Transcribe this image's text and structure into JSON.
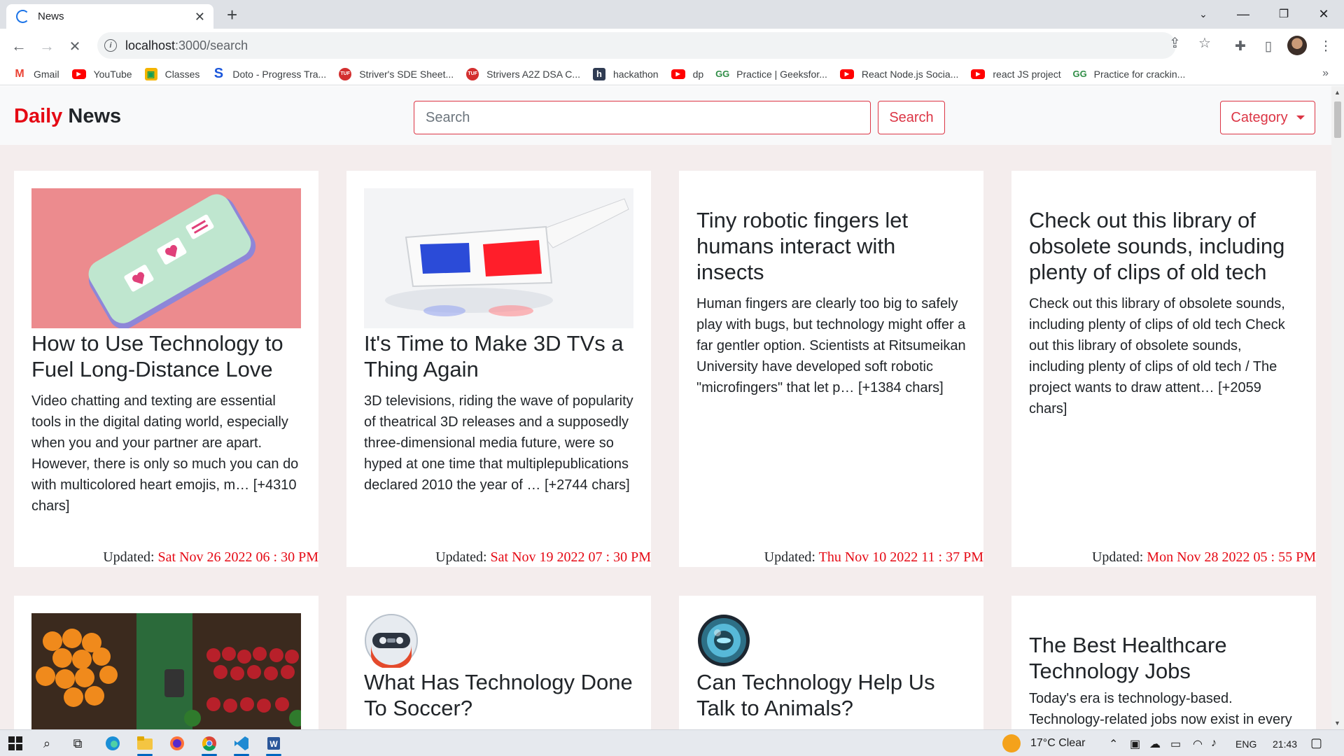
{
  "browser": {
    "tab_title": "News",
    "url_host": "localhost",
    "url_rest": ":3000/search",
    "bookmarks": [
      {
        "label": "Gmail",
        "icon": "gmail-icon"
      },
      {
        "label": "YouTube",
        "icon": "youtube-icon"
      },
      {
        "label": "Classes",
        "icon": "classroom-icon"
      },
      {
        "label": "Doto - Progress Tra...",
        "icon": "doto-icon"
      },
      {
        "label": "Striver's SDE Sheet...",
        "icon": "tuf-icon"
      },
      {
        "label": "Strivers A2Z DSA C...",
        "icon": "tuf-icon"
      },
      {
        "label": "hackathon",
        "icon": "hashnode-icon"
      },
      {
        "label": "dp",
        "icon": "youtube-icon"
      },
      {
        "label": "Practice | Geeksfor...",
        "icon": "gfg-icon"
      },
      {
        "label": "React Node.js Socia...",
        "icon": "youtube-icon"
      },
      {
        "label": "react JS project",
        "icon": "youtube-icon"
      },
      {
        "label": "Practice for crackin...",
        "icon": "gfg-icon"
      }
    ]
  },
  "navbar": {
    "brand_first": "Daily",
    "brand_second": "News",
    "search_placeholder": "Search",
    "search_button": "Search",
    "category_button": "Category"
  },
  "updated_label": "Updated:",
  "articles": [
    {
      "title": "How to Use Technology to Fuel Long-Distance Love",
      "description": "Video chatting and texting are essential tools in the digital dating world, especially when you and your partner are apart. However, there is only so much you can do with multicolored heart emojis, m… [+4310 chars]",
      "date": "Sat Nov 26 2022 06 : 30 PM",
      "image": "phone-hearts"
    },
    {
      "title": "It's Time to Make 3D TVs a Thing Again",
      "description": "3D televisions, riding the wave of popularity of theatrical 3D releases and a supposedly three-dimensional media future, were so hyped at one time that multiplepublications declared 2010 the year of … [+2744 chars]",
      "date": "Sat Nov 19 2022 07 : 30 PM",
      "image": "3d-glasses"
    },
    {
      "title": "Tiny robotic fingers let humans interact with insects",
      "description": "Human fingers are clearly too big to safely play with bugs, but technology might offer a far gentler option. Scientists at Ritsumeikan University have developed soft robotic \"microfingers\" that let p… [+1384 chars]",
      "date": "Thu Nov 10 2022 11 : 37 PM",
      "image": null
    },
    {
      "title": "Check out this library of obsolete sounds, including plenty of clips of old tech",
      "description": "Check out this library of obsolete sounds, including plenty of clips of old tech Check out this library of obsolete sounds, including plenty of clips of old tech / The project wants to draw attent… [+2059 chars]",
      "date": "Mon Nov 28 2022 05 : 55 PM",
      "image": null
    },
    {
      "title": "",
      "description": "",
      "date": "",
      "image": "market-produce"
    },
    {
      "title": "What Has Technology Done To Soccer?",
      "description": "",
      "date": "",
      "image": "robot-head"
    },
    {
      "title": "Can Technology Help Us Talk to Animals?",
      "description": "",
      "date": "",
      "image": "robot-eye"
    },
    {
      "title": "The Best Healthcare Technology Jobs",
      "description": "Today's era is technology-based. Technology-related jobs now exist in every",
      "date": "",
      "image": null
    }
  ],
  "taskbar": {
    "weather": "17°C  Clear",
    "language": "ENG",
    "time": "21:43"
  },
  "colors": {
    "brand_red": "#e50914",
    "bootstrap_danger": "#dc3545",
    "page_bg": "#f4eded"
  }
}
